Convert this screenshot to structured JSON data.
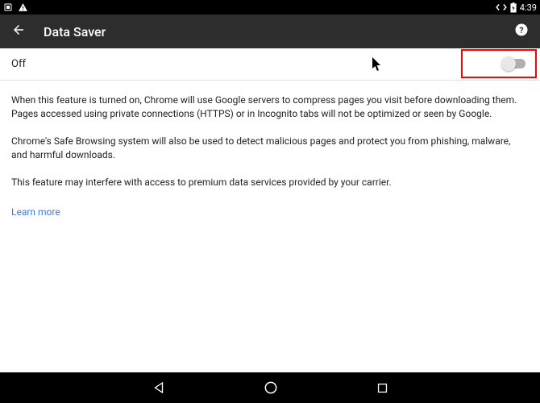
{
  "status": {
    "time": "4:39"
  },
  "header": {
    "title": "Data Saver"
  },
  "toggle": {
    "label": "Off",
    "on": false
  },
  "body": {
    "p1": "When this feature is turned on, Chrome will use Google servers to compress pages you visit before downloading them. Pages accessed using private connections (HTTPS) or in Incognito tabs will not be optimized or seen by Google.",
    "p2": "Chrome's Safe Browsing system will also be used to detect malicious pages and protect you from phishing, malware, and harmful downloads.",
    "p3": "This feature may interfere with access to premium data services provided by your carrier.",
    "learn_more": "Learn more"
  }
}
